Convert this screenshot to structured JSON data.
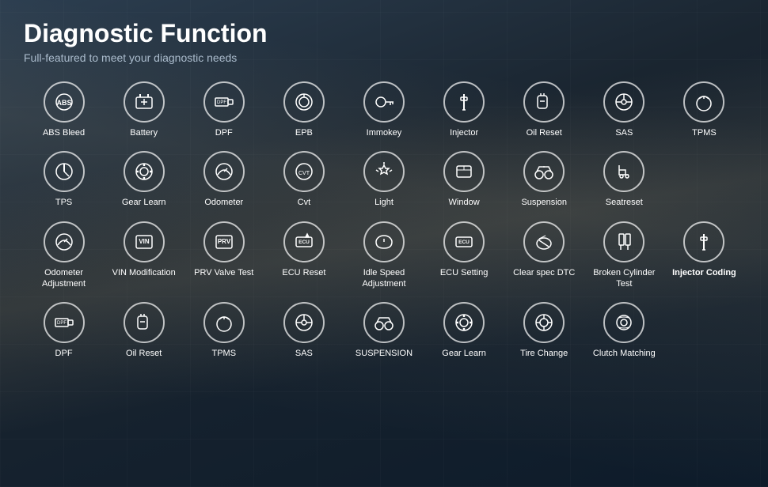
{
  "header": {
    "title": "Diagnostic Function",
    "subtitle": "Full-featured to meet your diagnostic needs"
  },
  "rows": [
    [
      {
        "id": "abs-bleed",
        "label": "ABS Bleed",
        "icon": "abs"
      },
      {
        "id": "battery",
        "label": "Battery",
        "icon": "battery"
      },
      {
        "id": "dpf",
        "label": "DPF",
        "icon": "dpf"
      },
      {
        "id": "epb",
        "label": "EPB",
        "icon": "epb"
      },
      {
        "id": "immokey",
        "label": "Immokey",
        "icon": "key"
      },
      {
        "id": "injector",
        "label": "Injector",
        "icon": "injector"
      },
      {
        "id": "oil-reset",
        "label": "Oil Reset",
        "icon": "oil"
      },
      {
        "id": "sas",
        "label": "SAS",
        "icon": "steering"
      },
      {
        "id": "tpms",
        "label": "TPMS",
        "icon": "tpms"
      }
    ],
    [
      {
        "id": "tps",
        "label": "TPS",
        "icon": "tps"
      },
      {
        "id": "gear-learn",
        "label": "Gear Learn",
        "icon": "gear"
      },
      {
        "id": "odometer",
        "label": "Odometer",
        "icon": "odometer"
      },
      {
        "id": "cvt",
        "label": "Cvt",
        "icon": "cvt"
      },
      {
        "id": "light",
        "label": "Light",
        "icon": "light"
      },
      {
        "id": "window",
        "label": "Window",
        "icon": "window"
      },
      {
        "id": "suspension",
        "label": "Suspension",
        "icon": "suspension"
      },
      {
        "id": "seatreset",
        "label": "Seatreset",
        "icon": "seat"
      },
      {
        "id": "empty1",
        "label": "",
        "icon": "none"
      }
    ],
    [
      {
        "id": "odometer-adj",
        "label": "Odometer\nAdjustment",
        "icon": "odometer2"
      },
      {
        "id": "vin-mod",
        "label": "VIN\nModification",
        "icon": "vin"
      },
      {
        "id": "prv-valve",
        "label": "PRV\nValve Test",
        "icon": "prv"
      },
      {
        "id": "ecu-reset",
        "label": "ECU Reset",
        "icon": "ecu-reset"
      },
      {
        "id": "idle-speed",
        "label": "Idle Speed\nAdjustment",
        "icon": "idle"
      },
      {
        "id": "ecu-setting",
        "label": "ECU Setting",
        "icon": "ecu"
      },
      {
        "id": "clear-dtc",
        "label": "Clear\nspec DTC",
        "icon": "clear-dtc"
      },
      {
        "id": "broken-cyl",
        "label": "Broken\nCylinder Test",
        "icon": "cylinder"
      },
      {
        "id": "injector-coding",
        "label": "Injector\nCoding",
        "icon": "injector2",
        "bold": true
      }
    ],
    [
      {
        "id": "dpf2",
        "label": "DPF",
        "icon": "dpf"
      },
      {
        "id": "oil-reset2",
        "label": "Oil Reset",
        "icon": "oil"
      },
      {
        "id": "tpms2",
        "label": "TPMS",
        "icon": "tpms"
      },
      {
        "id": "sas2",
        "label": "SAS",
        "icon": "steering"
      },
      {
        "id": "suspension2",
        "label": "SUSPENSION",
        "icon": "suspension2"
      },
      {
        "id": "gear-learn2",
        "label": "Gear Learn",
        "icon": "gear"
      },
      {
        "id": "tire-change",
        "label": "Tire Change",
        "icon": "tire"
      },
      {
        "id": "clutch",
        "label": "Clutch Matching",
        "icon": "clutch"
      },
      {
        "id": "empty2",
        "label": "",
        "icon": "none"
      }
    ]
  ]
}
